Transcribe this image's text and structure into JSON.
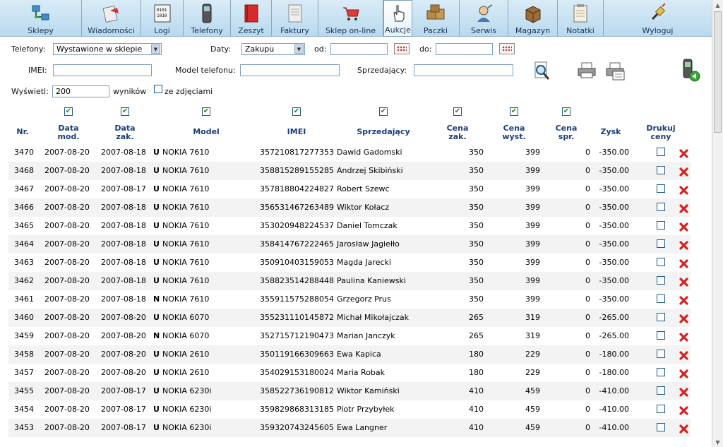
{
  "toolbar": [
    {
      "label": "Sklepy",
      "icon": "network-computers-icon"
    },
    {
      "label": "Wiadomości",
      "icon": "envelope-icon"
    },
    {
      "label": "Logi",
      "icon": "binary-log-icon"
    },
    {
      "label": "Telefony",
      "icon": "mobile-phone-icon"
    },
    {
      "label": "Zeszyt",
      "icon": "notebook-icon"
    },
    {
      "label": "Faktury",
      "icon": "invoice-icon"
    },
    {
      "label": "Sklep on-line",
      "icon": "shopping-cart-icon"
    },
    {
      "label": "Aukcje",
      "icon": "hand-cursor-icon"
    },
    {
      "label": "Paczki",
      "icon": "boxes-icon"
    },
    {
      "label": "Serwis",
      "icon": "service-tools-icon"
    },
    {
      "label": "Magazyn",
      "icon": "warehouse-box-icon"
    },
    {
      "label": "Notatki",
      "icon": "notepad-icon"
    },
    {
      "label": "Wyloguj",
      "icon": "logout-plug-icon"
    }
  ],
  "filters": {
    "telefony_label": "Telefony:",
    "telefony_value": "Wystawione w sklepie",
    "daty_label": "Daty:",
    "daty_value": "Zakupu",
    "od_label": "od:",
    "od_value": "",
    "do_label": "do:",
    "do_value": "",
    "imei_label": "IMEI:",
    "imei_value": "",
    "model_label": "Model telefonu:",
    "model_value": "",
    "seller_label": "Sprzedający:",
    "seller_value": "",
    "show_label": "Wyświetl:",
    "show_value": "200",
    "results_label": "wyników",
    "photos_label": "ze zdjęciami"
  },
  "columns": [
    {
      "label": "Nr.",
      "checkbox": false
    },
    {
      "label": "Data mod.",
      "checkbox": true
    },
    {
      "label": "Data zak.",
      "checkbox": true
    },
    {
      "label": "Model",
      "checkbox": true
    },
    {
      "label": "IMEI",
      "checkbox": true
    },
    {
      "label": "Sprzedający",
      "checkbox": true
    },
    {
      "label": "Cena zak.",
      "checkbox": true
    },
    {
      "label": "Cena wyst.",
      "checkbox": true
    },
    {
      "label": "Cena spr.",
      "checkbox": true
    },
    {
      "label": "Zysk",
      "checkbox": false
    },
    {
      "label": "Drukuj ceny",
      "checkbox": false
    }
  ],
  "rows": [
    {
      "nr": "3470",
      "mod": "2007-08-20",
      "zak": "2007-08-18",
      "type": "U",
      "model": "NOKIA 7610",
      "imei": "357210817277353",
      "seller": "Dawid Gadomski",
      "cz": "350",
      "cw": "399",
      "cs": "0",
      "zysk": "-350.00"
    },
    {
      "nr": "3468",
      "mod": "2007-08-20",
      "zak": "2007-08-18",
      "type": "U",
      "model": "NOKIA 7610",
      "imei": "358815289155285",
      "seller": "Andrzej Skibiński",
      "cz": "350",
      "cw": "399",
      "cs": "0",
      "zysk": "-350.00"
    },
    {
      "nr": "3467",
      "mod": "2007-08-20",
      "zak": "2007-08-17",
      "type": "U",
      "model": "NOKIA 7610",
      "imei": "357818804224827",
      "seller": "Robert Szewc",
      "cz": "350",
      "cw": "399",
      "cs": "0",
      "zysk": "-350.00"
    },
    {
      "nr": "3466",
      "mod": "2007-08-20",
      "zak": "2007-08-18",
      "type": "U",
      "model": "NOKIA 7610",
      "imei": "356531467263489",
      "seller": "Wiktor Kołacz",
      "cz": "350",
      "cw": "399",
      "cs": "0",
      "zysk": "-350.00"
    },
    {
      "nr": "3465",
      "mod": "2007-08-20",
      "zak": "2007-08-18",
      "type": "U",
      "model": "NOKIA 7610",
      "imei": "353020948224537",
      "seller": "Daniel Tomczak",
      "cz": "350",
      "cw": "399",
      "cs": "0",
      "zysk": "-350.00"
    },
    {
      "nr": "3464",
      "mod": "2007-08-20",
      "zak": "2007-08-18",
      "type": "U",
      "model": "NOKIA 7610",
      "imei": "358414767222465",
      "seller": "Jarosław Jagiełło",
      "cz": "350",
      "cw": "399",
      "cs": "0",
      "zysk": "-350.00"
    },
    {
      "nr": "3463",
      "mod": "2007-08-20",
      "zak": "2007-08-18",
      "type": "U",
      "model": "NOKIA 7610",
      "imei": "350910403159053",
      "seller": "Magda Jarecki",
      "cz": "350",
      "cw": "399",
      "cs": "0",
      "zysk": "-350.00"
    },
    {
      "nr": "3462",
      "mod": "2007-08-20",
      "zak": "2007-08-18",
      "type": "U",
      "model": "NOKIA 7610",
      "imei": "358823514288448",
      "seller": "Paulina Kaniewski",
      "cz": "350",
      "cw": "399",
      "cs": "0",
      "zysk": "-350.00"
    },
    {
      "nr": "3461",
      "mod": "2007-08-20",
      "zak": "2007-08-18",
      "type": "N",
      "model": "NOKIA 7610",
      "imei": "355911575288054",
      "seller": "Grzegorz Prus",
      "cz": "350",
      "cw": "399",
      "cs": "0",
      "zysk": "-350.00"
    },
    {
      "nr": "3460",
      "mod": "2007-08-20",
      "zak": "2007-08-20",
      "type": "U",
      "model": "NOKIA 6070",
      "imei": "355231110145872",
      "seller": "Michał Mikołajczak",
      "cz": "265",
      "cw": "319",
      "cs": "0",
      "zysk": "-265.00"
    },
    {
      "nr": "3459",
      "mod": "2007-08-20",
      "zak": "2007-08-20",
      "type": "N",
      "model": "NOKIA 6070",
      "imei": "352715712190473",
      "seller": "Marian Janczyk",
      "cz": "265",
      "cw": "319",
      "cs": "0",
      "zysk": "-265.00"
    },
    {
      "nr": "3458",
      "mod": "2007-08-20",
      "zak": "2007-08-20",
      "type": "U",
      "model": "NOKIA 2610",
      "imei": "350119166309663",
      "seller": "Ewa Kapica",
      "cz": "180",
      "cw": "229",
      "cs": "0",
      "zysk": "-180.00"
    },
    {
      "nr": "3457",
      "mod": "2007-08-20",
      "zak": "2007-08-20",
      "type": "U",
      "model": "NOKIA 2610",
      "imei": "354029153180024",
      "seller": "Maria Robak",
      "cz": "180",
      "cw": "229",
      "cs": "0",
      "zysk": "-180.00"
    },
    {
      "nr": "3455",
      "mod": "2007-08-20",
      "zak": "2007-08-17",
      "type": "U",
      "model": "NOKIA 6230i",
      "imei": "358522736190812",
      "seller": "Wiktor Kamiński",
      "cz": "410",
      "cw": "459",
      "cs": "0",
      "zysk": "-410.00"
    },
    {
      "nr": "3454",
      "mod": "2007-08-20",
      "zak": "2007-08-17",
      "type": "U",
      "model": "NOKIA 6230i",
      "imei": "359829868313185",
      "seller": "Piotr Przybyłek",
      "cz": "410",
      "cw": "459",
      "cs": "0",
      "zysk": "-410.00"
    },
    {
      "nr": "3453",
      "mod": "2007-08-20",
      "zak": "2007-08-17",
      "type": "U",
      "model": "NOKIA 6230i",
      "imei": "359320743245605",
      "seller": "Ewa Langner",
      "cz": "410",
      "cw": "459",
      "cs": "0",
      "zysk": "-410.00"
    }
  ]
}
